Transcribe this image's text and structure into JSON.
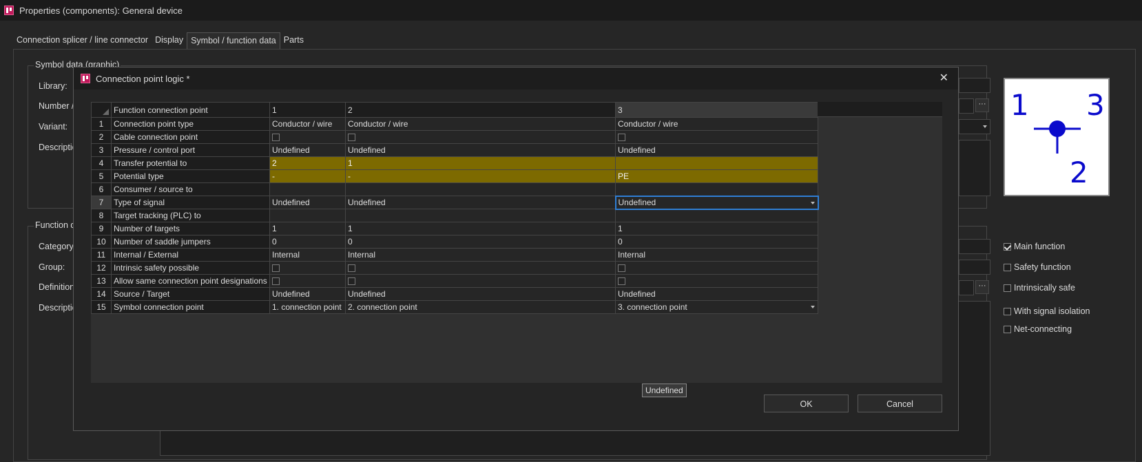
{
  "window": {
    "title": "Properties (components): General device"
  },
  "tabs": [
    {
      "label": "Connection splicer / line connector"
    },
    {
      "label": "Display"
    },
    {
      "label": "Symbol / function data"
    },
    {
      "label": "Parts"
    }
  ],
  "symbol_group": {
    "title": "Symbol data (graphic)",
    "labels": {
      "library": "Library:",
      "number": "Number /",
      "variant": "Variant:",
      "description": "Descriptio"
    }
  },
  "function_group": {
    "title": "Function d",
    "labels": {
      "category": "Category:",
      "group": "Group:",
      "definition": "Definition",
      "description": "Descriptio"
    }
  },
  "symbol_preview": {
    "labels": [
      "1",
      "3",
      "2"
    ],
    "color": "#0a0acc"
  },
  "checkboxes": [
    {
      "label": "Main function",
      "checked": true
    },
    {
      "label": "Safety function",
      "checked": false
    },
    {
      "label": "Intrinsically safe",
      "checked": false
    },
    {
      "label": "With signal isolation",
      "checked": false
    },
    {
      "label": "Net-connecting",
      "checked": false
    }
  ],
  "dialog": {
    "title": "Connection point logic *",
    "close": "✕",
    "ok": "OK",
    "cancel": "Cancel",
    "tooltip": "Undefined",
    "grid": {
      "header": {
        "label": "Function connection point",
        "columns": [
          "1",
          "2",
          "3"
        ]
      },
      "rows": [
        {
          "n": "1",
          "label": "Connection point type",
          "values": [
            "Conductor / wire",
            "Conductor / wire",
            "Conductor / wire"
          ]
        },
        {
          "n": "2",
          "label": "Cable connection point",
          "values": [
            "",
            "",
            ""
          ]
        },
        {
          "n": "3",
          "label": "Pressure / control port",
          "values": [
            "Undefined",
            "Undefined",
            "Undefined"
          ]
        },
        {
          "n": "4",
          "label": "Transfer potential to",
          "values": [
            "2",
            "1",
            ""
          ]
        },
        {
          "n": "5",
          "label": "Potential type",
          "values": [
            "-",
            "-",
            "PE"
          ]
        },
        {
          "n": "6",
          "label": "Consumer / source to",
          "values": [
            "",
            "",
            ""
          ]
        },
        {
          "n": "7",
          "label": "Type of signal",
          "values": [
            "Undefined",
            "Undefined",
            "Undefined"
          ]
        },
        {
          "n": "8",
          "label": "Target tracking (PLC) to",
          "values": [
            "",
            "",
            ""
          ]
        },
        {
          "n": "9",
          "label": "Number of targets",
          "values": [
            "1",
            "1",
            "1"
          ]
        },
        {
          "n": "10",
          "label": "Number of saddle jumpers",
          "values": [
            "0",
            "0",
            "0"
          ]
        },
        {
          "n": "11",
          "label": "Internal / External",
          "values": [
            "Internal",
            "Internal",
            "Internal"
          ]
        },
        {
          "n": "12",
          "label": "Intrinsic safety possible",
          "values": [
            "",
            "",
            ""
          ]
        },
        {
          "n": "13",
          "label": "Allow same connection point designations",
          "values": [
            "",
            "",
            ""
          ]
        },
        {
          "n": "14",
          "label": "Source / Target",
          "values": [
            "Undefined",
            "Undefined",
            "Undefined"
          ]
        },
        {
          "n": "15",
          "label": "Symbol connection point",
          "values": [
            "1. connection point",
            "2. connection point",
            "3. connection point"
          ]
        }
      ]
    }
  },
  "colors": {
    "highlight": "#7d6a00",
    "selection": "#2f7fd6",
    "app_icon": "#c2185b"
  }
}
